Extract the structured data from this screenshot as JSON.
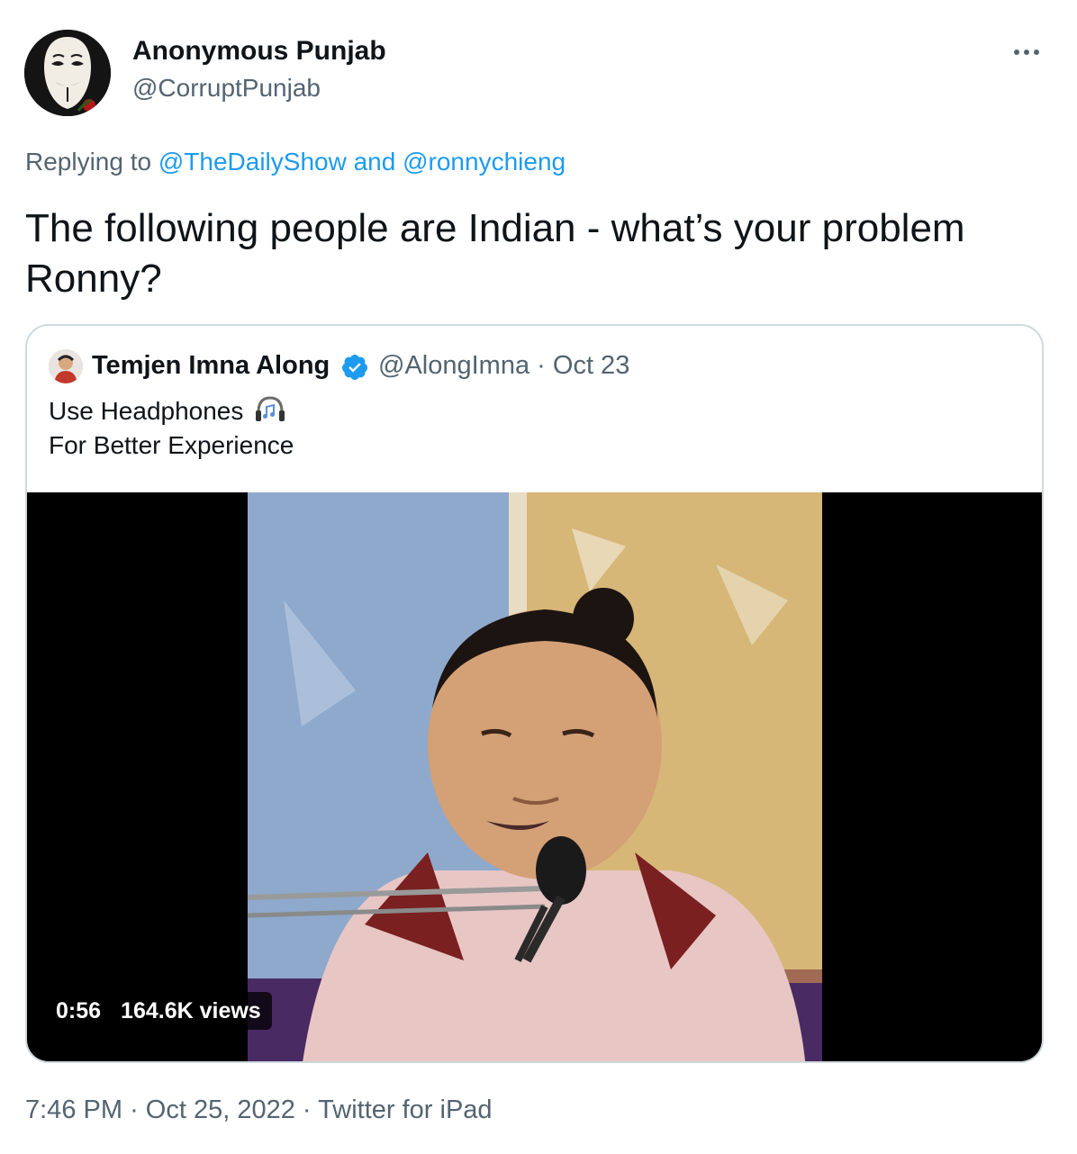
{
  "tweet": {
    "author_name": "Anonymous Punjab",
    "author_handle": "@CorruptPunjab",
    "more_icon": "more-horizontal-icon",
    "reply_prefix": "Replying to",
    "reply_mention_1": "@TheDailyShow",
    "reply_and": "and",
    "reply_mention_2": "@ronnychieng",
    "text": "The following people are Indian - what’s your problem Ronny?",
    "time": "7:46 PM",
    "separator": "·",
    "date": "Oct 25, 2022",
    "source": "Twitter for iPad"
  },
  "quote": {
    "author_name": "Temjen Imna Along",
    "verified_icon": "verified-badge-icon",
    "author_handle": "@AlongImna",
    "separator": "·",
    "date": "Oct 23",
    "text_line_1": "Use Headphones",
    "headphones_icon": "headphones-icon",
    "text_line_2": "For Better Experience",
    "video_duration": "0:56",
    "video_views": "164.6K views"
  },
  "colors": {
    "link": "#1d9bf0",
    "secondary_text": "#536471",
    "primary_text": "#0f1419",
    "border": "#cfd9de"
  }
}
